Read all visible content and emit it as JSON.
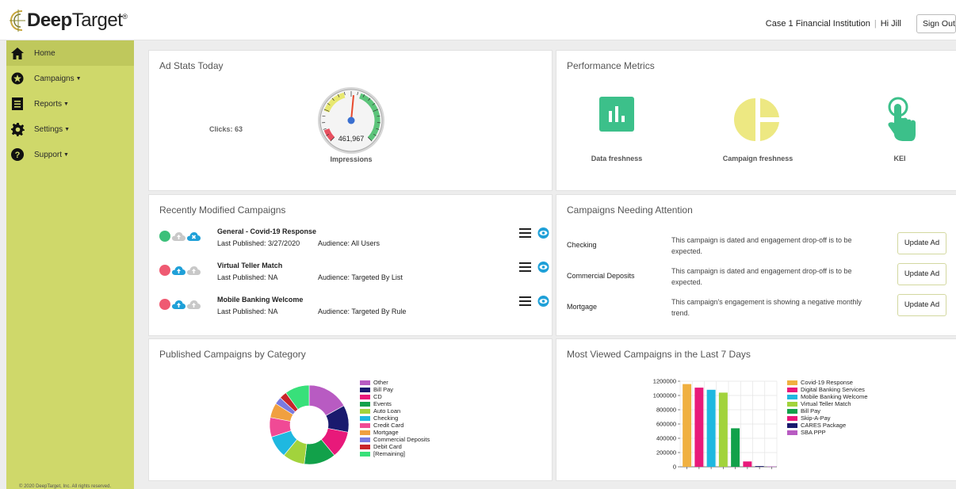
{
  "header": {
    "logo_bold": "Deep",
    "logo_light": "Target",
    "logo_reg": "®",
    "institution": "Case 1 Financial Institution",
    "separator": "|",
    "greeting": "Hi Jill",
    "signout_label": "Sign Out"
  },
  "sidebar": {
    "items": [
      {
        "label": "Home",
        "icon": "home-icon"
      },
      {
        "label": "Campaigns",
        "icon": "campaign-icon",
        "caret": "▼"
      },
      {
        "label": "Reports",
        "icon": "reports-icon",
        "caret": "▼"
      },
      {
        "label": "Settings",
        "icon": "gear-icon",
        "caret": "▼"
      },
      {
        "label": "Support",
        "icon": "help-icon",
        "caret": "▼"
      }
    ],
    "copyright": "© 2020 DeepTarget, Inc. All rights reserved."
  },
  "ad_stats": {
    "title": "Ad Stats Today",
    "clicks": "Clicks: 63",
    "impressions_value": "461,967",
    "impressions_label": "Impressions",
    "gauge_fraction": 0.52
  },
  "performance": {
    "title": "Performance Metrics",
    "metrics": [
      {
        "label": "Data freshness",
        "icon": "bar-chart-icon"
      },
      {
        "label": "Campaign freshness",
        "icon": "pie-chart-icon"
      },
      {
        "label": "KEI",
        "icon": "pointer-hand-icon"
      }
    ]
  },
  "recent": {
    "title": "Recently Modified Campaigns",
    "rows": [
      {
        "name": "General - Covid-19 Response",
        "published": "Last Published:  3/27/2020",
        "audience": "Audience: All Users",
        "status_color": "#3cc07a"
      },
      {
        "name": "Virtual Teller Match",
        "published": "Last Published: NA",
        "audience": "Audience: Targeted By List",
        "status_color": "#ef5a72"
      },
      {
        "name": "Mobile Banking Welcome",
        "published": "Last Published: NA",
        "audience": "Audience: Targeted By Rule",
        "status_color": "#ef5a72"
      }
    ]
  },
  "attention": {
    "title": "Campaigns Needing Attention",
    "button_label": "Update Ad",
    "rows": [
      {
        "name": "Checking",
        "message": "This campaign is dated and engagement drop-off is to be expected."
      },
      {
        "name": "Commercial Deposits",
        "message": "This campaign is dated and engagement drop-off is to be expected."
      },
      {
        "name": "Mortgage",
        "message": "This campaign's engagement is showing a negative monthly trend."
      }
    ]
  },
  "category_chart": {
    "title": "Published Campaigns by Category"
  },
  "views_chart": {
    "title": "Most Viewed Campaigns in the Last 7 Days"
  },
  "chart_data": [
    {
      "type": "pie",
      "title": "Published Campaigns by Category",
      "categories": [
        "Other",
        "Bill Pay",
        "CD",
        "Events",
        "Auto Loan",
        "Checking",
        "Credit Card",
        "Mortgage",
        "Commercial Deposits",
        "Debit Card",
        "[Remaining]"
      ],
      "values": [
        17,
        11,
        11,
        13,
        9,
        9,
        8,
        6,
        3,
        3,
        10
      ],
      "colors": [
        "#b85bc2",
        "#1a1a6e",
        "#e8197a",
        "#12a14a",
        "#a2d33c",
        "#1fb8e0",
        "#f04a95",
        "#f0a040",
        "#7a7ae0",
        "#c8252a",
        "#38e07a"
      ],
      "legend": "right"
    },
    {
      "type": "bar",
      "title": "Most Viewed Campaigns in the Last 7 Days",
      "categories": [
        "Covid-19 Response",
        "Digital Banking Services",
        "Mobile Banking Welcome",
        "Virtual Teller Match",
        "Bill Pay",
        "Skip-A-Pay",
        "CARES Package",
        "SBA PPP"
      ],
      "values": [
        1160000,
        1110000,
        1080000,
        1040000,
        540000,
        75000,
        10000,
        5000
      ],
      "colors": [
        "#f0b040",
        "#e8197a",
        "#1fb8e0",
        "#a2d33c",
        "#12a14a",
        "#e8197a",
        "#1a1a6e",
        "#b85bc2"
      ],
      "yticks": [
        "1200000",
        "1000000",
        "800000",
        "600000",
        "400000",
        "200000",
        "0"
      ],
      "ylim": [
        0,
        1200000
      ],
      "grid": true,
      "legend": "right"
    }
  ]
}
